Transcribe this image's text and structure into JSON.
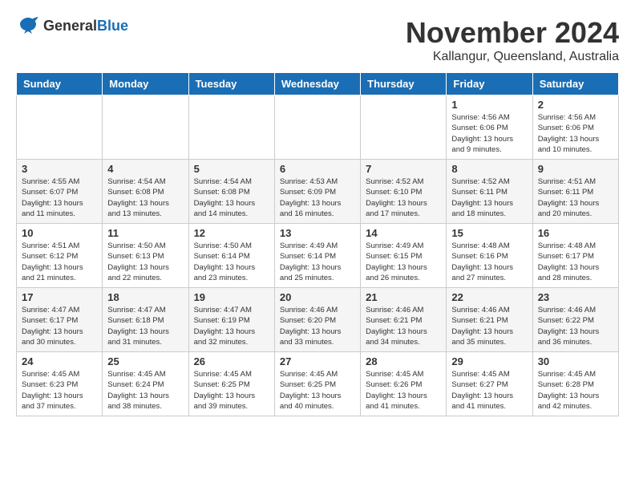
{
  "header": {
    "logo_general": "General",
    "logo_blue": "Blue",
    "month": "November 2024",
    "location": "Kallangur, Queensland, Australia"
  },
  "weekdays": [
    "Sunday",
    "Monday",
    "Tuesday",
    "Wednesday",
    "Thursday",
    "Friday",
    "Saturday"
  ],
  "weeks": [
    [
      {
        "day": "",
        "info": ""
      },
      {
        "day": "",
        "info": ""
      },
      {
        "day": "",
        "info": ""
      },
      {
        "day": "",
        "info": ""
      },
      {
        "day": "",
        "info": ""
      },
      {
        "day": "1",
        "info": "Sunrise: 4:56 AM\nSunset: 6:06 PM\nDaylight: 13 hours and 9 minutes."
      },
      {
        "day": "2",
        "info": "Sunrise: 4:56 AM\nSunset: 6:06 PM\nDaylight: 13 hours and 10 minutes."
      }
    ],
    [
      {
        "day": "3",
        "info": "Sunrise: 4:55 AM\nSunset: 6:07 PM\nDaylight: 13 hours and 11 minutes."
      },
      {
        "day": "4",
        "info": "Sunrise: 4:54 AM\nSunset: 6:08 PM\nDaylight: 13 hours and 13 minutes."
      },
      {
        "day": "5",
        "info": "Sunrise: 4:54 AM\nSunset: 6:08 PM\nDaylight: 13 hours and 14 minutes."
      },
      {
        "day": "6",
        "info": "Sunrise: 4:53 AM\nSunset: 6:09 PM\nDaylight: 13 hours and 16 minutes."
      },
      {
        "day": "7",
        "info": "Sunrise: 4:52 AM\nSunset: 6:10 PM\nDaylight: 13 hours and 17 minutes."
      },
      {
        "day": "8",
        "info": "Sunrise: 4:52 AM\nSunset: 6:11 PM\nDaylight: 13 hours and 18 minutes."
      },
      {
        "day": "9",
        "info": "Sunrise: 4:51 AM\nSunset: 6:11 PM\nDaylight: 13 hours and 20 minutes."
      }
    ],
    [
      {
        "day": "10",
        "info": "Sunrise: 4:51 AM\nSunset: 6:12 PM\nDaylight: 13 hours and 21 minutes."
      },
      {
        "day": "11",
        "info": "Sunrise: 4:50 AM\nSunset: 6:13 PM\nDaylight: 13 hours and 22 minutes."
      },
      {
        "day": "12",
        "info": "Sunrise: 4:50 AM\nSunset: 6:14 PM\nDaylight: 13 hours and 23 minutes."
      },
      {
        "day": "13",
        "info": "Sunrise: 4:49 AM\nSunset: 6:14 PM\nDaylight: 13 hours and 25 minutes."
      },
      {
        "day": "14",
        "info": "Sunrise: 4:49 AM\nSunset: 6:15 PM\nDaylight: 13 hours and 26 minutes."
      },
      {
        "day": "15",
        "info": "Sunrise: 4:48 AM\nSunset: 6:16 PM\nDaylight: 13 hours and 27 minutes."
      },
      {
        "day": "16",
        "info": "Sunrise: 4:48 AM\nSunset: 6:17 PM\nDaylight: 13 hours and 28 minutes."
      }
    ],
    [
      {
        "day": "17",
        "info": "Sunrise: 4:47 AM\nSunset: 6:17 PM\nDaylight: 13 hours and 30 minutes."
      },
      {
        "day": "18",
        "info": "Sunrise: 4:47 AM\nSunset: 6:18 PM\nDaylight: 13 hours and 31 minutes."
      },
      {
        "day": "19",
        "info": "Sunrise: 4:47 AM\nSunset: 6:19 PM\nDaylight: 13 hours and 32 minutes."
      },
      {
        "day": "20",
        "info": "Sunrise: 4:46 AM\nSunset: 6:20 PM\nDaylight: 13 hours and 33 minutes."
      },
      {
        "day": "21",
        "info": "Sunrise: 4:46 AM\nSunset: 6:21 PM\nDaylight: 13 hours and 34 minutes."
      },
      {
        "day": "22",
        "info": "Sunrise: 4:46 AM\nSunset: 6:21 PM\nDaylight: 13 hours and 35 minutes."
      },
      {
        "day": "23",
        "info": "Sunrise: 4:46 AM\nSunset: 6:22 PM\nDaylight: 13 hours and 36 minutes."
      }
    ],
    [
      {
        "day": "24",
        "info": "Sunrise: 4:45 AM\nSunset: 6:23 PM\nDaylight: 13 hours and 37 minutes."
      },
      {
        "day": "25",
        "info": "Sunrise: 4:45 AM\nSunset: 6:24 PM\nDaylight: 13 hours and 38 minutes."
      },
      {
        "day": "26",
        "info": "Sunrise: 4:45 AM\nSunset: 6:25 PM\nDaylight: 13 hours and 39 minutes."
      },
      {
        "day": "27",
        "info": "Sunrise: 4:45 AM\nSunset: 6:25 PM\nDaylight: 13 hours and 40 minutes."
      },
      {
        "day": "28",
        "info": "Sunrise: 4:45 AM\nSunset: 6:26 PM\nDaylight: 13 hours and 41 minutes."
      },
      {
        "day": "29",
        "info": "Sunrise: 4:45 AM\nSunset: 6:27 PM\nDaylight: 13 hours and 41 minutes."
      },
      {
        "day": "30",
        "info": "Sunrise: 4:45 AM\nSunset: 6:28 PM\nDaylight: 13 hours and 42 minutes."
      }
    ]
  ]
}
